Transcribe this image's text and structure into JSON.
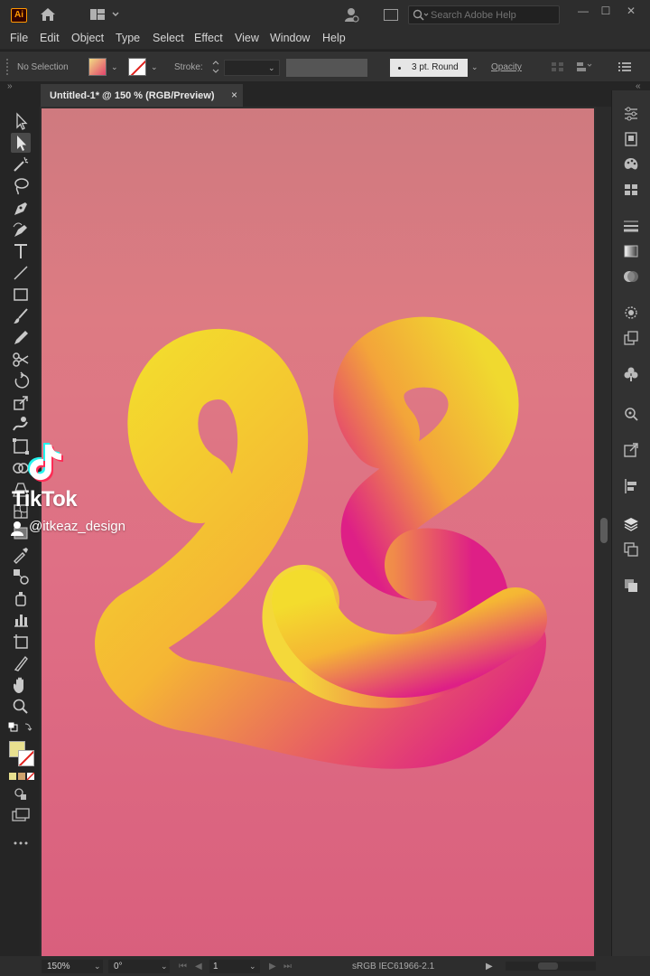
{
  "app": {
    "logo_text": "Ai",
    "search_placeholder": "Search Adobe Help",
    "window_buttons": [
      "—",
      "☐",
      "✕"
    ]
  },
  "menu": [
    "File",
    "Edit",
    "Object",
    "Type",
    "Select",
    "Effect",
    "View",
    "Window",
    "Help"
  ],
  "control_bar": {
    "selection_label": "No Selection",
    "stroke_label": "Stroke:",
    "brush_profile": "3 pt. Round",
    "opacity_label": "Opacity"
  },
  "document_tab": {
    "title": "Untitled-1* @ 150 % (RGB/Preview)",
    "close": "×"
  },
  "overlay": {
    "brand": "TikTok",
    "username": "@itkeaz_design"
  },
  "status_bar": {
    "zoom": "150%",
    "rotation": "0°",
    "artboard_number": "1",
    "color_profile": "sRGB IEC61966-2.1"
  },
  "colors": {
    "accent_yellow": "#f3dc2d",
    "accent_magenta": "#de1f86",
    "artboard_bg": "#dc7482"
  }
}
